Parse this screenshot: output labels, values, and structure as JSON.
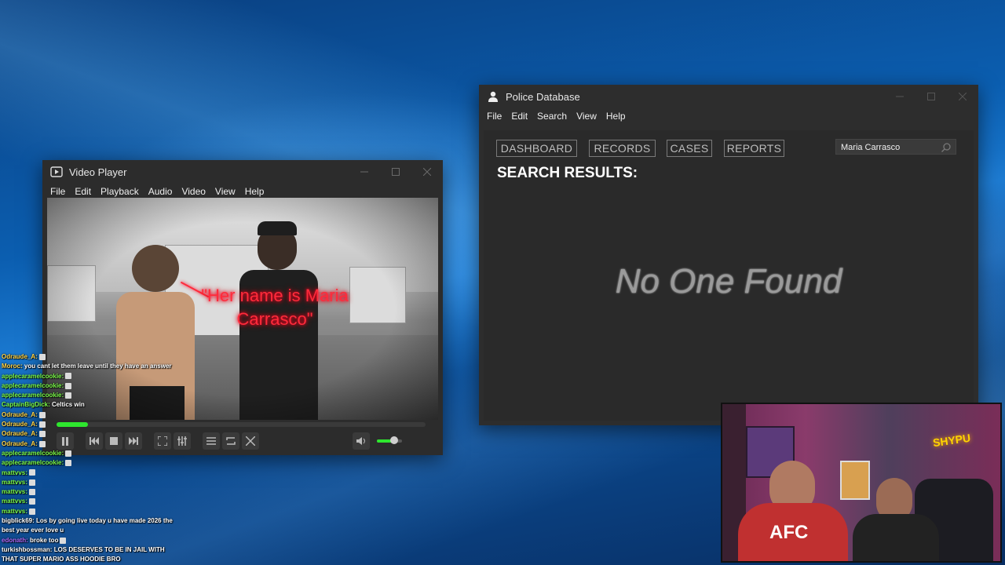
{
  "video_player": {
    "title": "Video Player",
    "menu": [
      "File",
      "Edit",
      "Playback",
      "Audio",
      "Video",
      "View",
      "Help"
    ],
    "overlay_quote": "\"Her name is Maria Carrasco\"",
    "progress": 0.085,
    "volume": 0.7
  },
  "police_db": {
    "title": "Police Database",
    "menu": [
      "File",
      "Edit",
      "Search",
      "View",
      "Help"
    ],
    "tabs": [
      "DASHBOARD",
      "RECORDS",
      "CASES",
      "REPORTS"
    ],
    "search_value": "Maria Carrasco",
    "results_heading": "SEARCH RESULTS:",
    "empty_message": "No One Found"
  },
  "chat": [
    {
      "user": "Odraude_A:",
      "color": "#ffd54a",
      "msg": "",
      "emote": true
    },
    {
      "user": "Moroc:",
      "color": "#ffd54a",
      "msg": "you cant let them leave until they have an answer",
      "emote": false
    },
    {
      "user": "applecaramelcookie:",
      "color": "#7cfc4a",
      "msg": "",
      "emote": true
    },
    {
      "user": "applecaramelcookie:",
      "color": "#7cfc4a",
      "msg": "",
      "emote": true
    },
    {
      "user": "applecaramelcookie:",
      "color": "#7cfc4a",
      "msg": "",
      "emote": true
    },
    {
      "user": "CaptainBigDick:",
      "color": "#7cfc4a",
      "msg": "Celtics win",
      "emote": false
    },
    {
      "user": "Odraude_A:",
      "color": "#ffd54a",
      "msg": "",
      "emote": true
    },
    {
      "user": "Odraude_A:",
      "color": "#ffd54a",
      "msg": "",
      "emote": true
    },
    {
      "user": "Odraude_A:",
      "color": "#ffd54a",
      "msg": "",
      "emote": true
    },
    {
      "user": "Odraude_A:",
      "color": "#ffd54a",
      "msg": "",
      "emote": true
    },
    {
      "user": "applecaramelcookie:",
      "color": "#7cfc4a",
      "msg": "",
      "emote": true
    },
    {
      "user": "applecaramelcookie:",
      "color": "#7cfc4a",
      "msg": "",
      "emote": true
    },
    {
      "user": "mattvvs:",
      "color": "#7cfc4a",
      "msg": "",
      "emote": true
    },
    {
      "user": "mattvvs:",
      "color": "#7cfc4a",
      "msg": "",
      "emote": true
    },
    {
      "user": "mattvvs:",
      "color": "#7cfc4a",
      "msg": "",
      "emote": true
    },
    {
      "user": "mattvvs:",
      "color": "#7cfc4a",
      "msg": "",
      "emote": true
    },
    {
      "user": "mattvvs:",
      "color": "#7cfc4a",
      "msg": "",
      "emote": true
    },
    {
      "user": "bigblick69:",
      "color": "#ffffff",
      "msg": "Los by going live today u have made 2026 the best year ever love u",
      "emote": false
    },
    {
      "user": "edonath:",
      "color": "#b06cff",
      "msg": "broke too",
      "emote": true
    },
    {
      "user": "turkishbossman:",
      "color": "#ffffff",
      "msg": "LOS DESERVES TO BE IN JAIL WITH THAT SUPER MARIO ASS HOODIE BRO",
      "emote": false
    }
  ],
  "webcam": {
    "neon_sign": "SHYPU",
    "shirt_text": "AFC"
  },
  "colors": {
    "accent_green": "#2ee62e",
    "quote_red": "#ff2b3b",
    "window_bg": "#2b2b2b"
  }
}
